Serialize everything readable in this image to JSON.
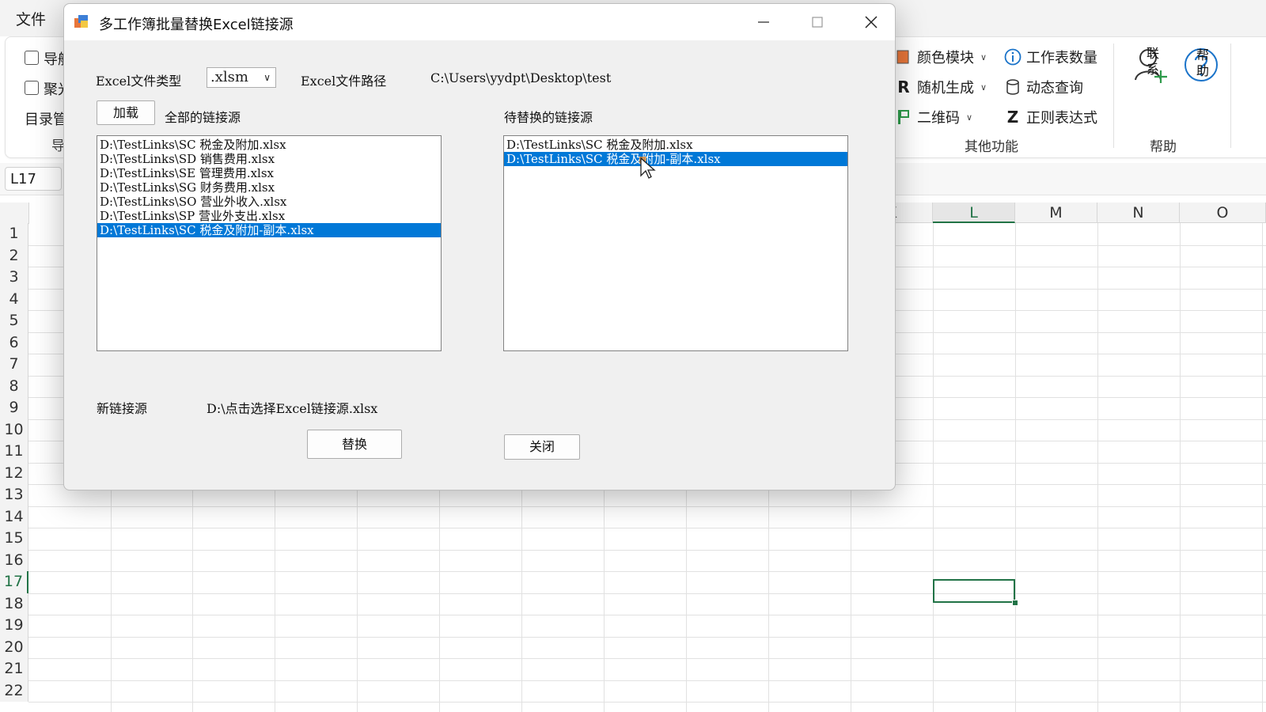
{
  "excel": {
    "menu_file": "文件",
    "ribbon_left": [
      {
        "label": "导航",
        "checked": false
      },
      {
        "label": "聚光",
        "checked": false
      }
    ],
    "ribbon_left_group_text": "目录管",
    "ribbon_left_group_label": "导",
    "other_features": {
      "col1": [
        {
          "label": "颜色模块",
          "icon": "color-module-icon"
        },
        {
          "label": "随机生成",
          "icon": "random-r-icon"
        },
        {
          "label": "二维码",
          "icon": "qr-flag-icon"
        }
      ],
      "col2": [
        {
          "label": "工作表数量",
          "icon": "info-icon"
        },
        {
          "label": "动态查询",
          "icon": "database-icon"
        },
        {
          "label": "正则表达式",
          "icon": "regex-z-icon"
        }
      ],
      "group_label": "其他功能"
    },
    "help_group": {
      "contact_label": "联系",
      "help_label": "帮助",
      "group_label": "帮助"
    },
    "name_box": "L17",
    "columns": [
      "K",
      "L",
      "M",
      "N",
      "O"
    ],
    "rows": [
      "1",
      "2",
      "3",
      "4",
      "5",
      "6",
      "7",
      "8",
      "9",
      "10",
      "11",
      "12",
      "13",
      "14",
      "15",
      "16",
      "17",
      "18",
      "19",
      "20",
      "21",
      "22"
    ],
    "selected_column": "L",
    "selected_row": "17"
  },
  "dialog": {
    "title": "多工作簿批量替换Excel链接源",
    "file_type_label": "Excel文件类型",
    "file_type_value": ".xlsm",
    "file_path_label": "Excel文件路径",
    "file_path_value": "C:\\Users\\yydpt\\Desktop\\test",
    "load_button": "加载",
    "all_links_label": "全部的链接源",
    "to_replace_label": "待替换的链接源",
    "all_links": [
      "D:\\TestLinks\\SC 税金及附加.xlsx",
      "D:\\TestLinks\\SD 销售费用.xlsx",
      "D:\\TestLinks\\SE 管理费用.xlsx",
      "D:\\TestLinks\\SG 财务费用.xlsx",
      "D:\\TestLinks\\SO 营业外收入.xlsx",
      "D:\\TestLinks\\SP 营业外支出.xlsx",
      "D:\\TestLinks\\SC 税金及附加-副本.xlsx"
    ],
    "all_links_selected_index": 6,
    "replace_links": [
      "D:\\TestLinks\\SC 税金及附加.xlsx",
      "D:\\TestLinks\\SC 税金及附加-副本.xlsx"
    ],
    "replace_links_selected_index": 1,
    "new_link_label": "新链接源",
    "new_link_value": "D:\\点击选择Excel链接源.xlsx",
    "replace_button": "替换",
    "close_button": "关闭"
  },
  "colors": {
    "excel_green": "#217346",
    "selection_blue": "#0078d7"
  }
}
